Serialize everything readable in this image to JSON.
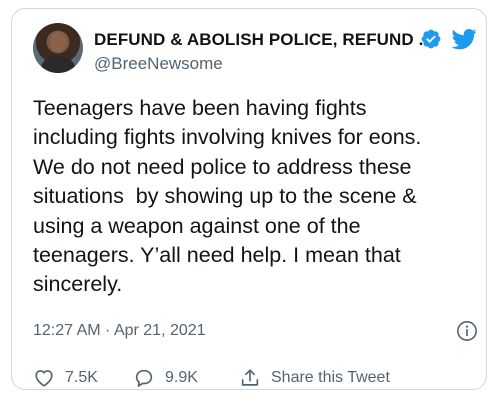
{
  "author": {
    "display_name": "DEFUND & ABOLISH POLICE, REFUND ...",
    "handle": "@BreeNewsome",
    "verified": true
  },
  "tweet": {
    "text": "Teenagers have been having fights\nincluding fights involving knives for eons.\nWe do not need police to address these\nsituations  by showing up to the scene &\nusing a weapon against one of the\nteenagers. Y’all need help. I mean that\nsincerely.",
    "timestamp": "12:27 AM · Apr 21, 2021"
  },
  "actions": {
    "likes": "7.5K",
    "replies": "9.9K",
    "share_label": "Share this Tweet"
  },
  "icons": {
    "verified": "verified-badge-icon",
    "brand": "twitter-bird-icon",
    "info": "info-icon",
    "like": "heart-icon",
    "reply": "speech-bubble-icon",
    "share": "share-upload-icon"
  },
  "colors": {
    "brand_blue": "#1d9bf0",
    "text_primary": "#0f1419",
    "text_secondary": "#536471",
    "border": "#cfd9de"
  }
}
